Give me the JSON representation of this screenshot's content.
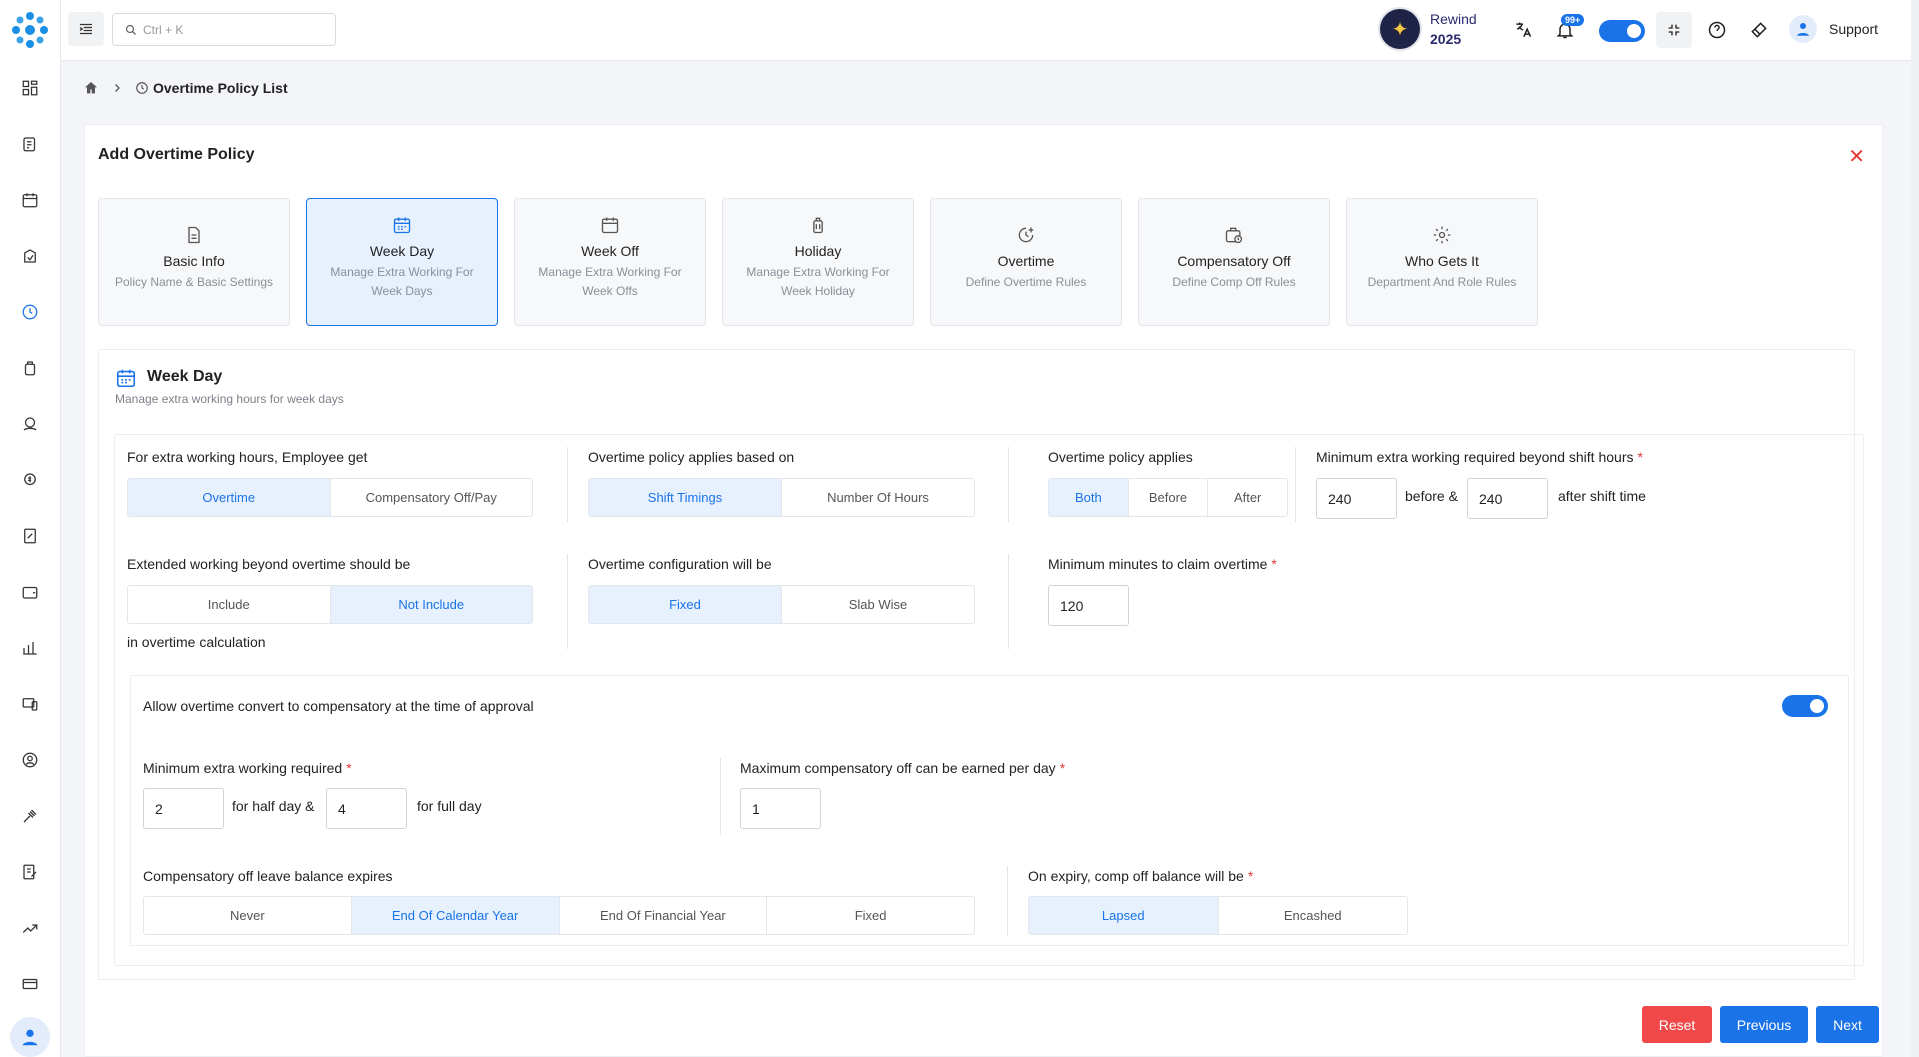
{
  "search": {
    "placeholder": "Ctrl + K"
  },
  "header": {
    "rewind_label": "Rewind",
    "rewind_year": "2025",
    "notifications_count": "99+",
    "support_label": "Support"
  },
  "breadcrumb": {
    "current": "Overtime Policy List"
  },
  "card": {
    "title": "Add Overtime Policy"
  },
  "steps": [
    {
      "title": "Basic Info",
      "sub": "Policy Name & Basic Settings",
      "icon": "document-icon"
    },
    {
      "title": "Week Day",
      "sub": "Manage Extra Working For Week Days",
      "icon": "calendar-icon"
    },
    {
      "title": "Week Off",
      "sub": "Manage Extra Working For Week Offs",
      "icon": "calendar-blank-icon"
    },
    {
      "title": "Holiday",
      "sub": "Manage Extra Working For Week Holiday",
      "icon": "luggage-icon"
    },
    {
      "title": "Overtime",
      "sub": "Define Overtime Rules",
      "icon": "clock-plus-icon"
    },
    {
      "title": "Compensatory Off",
      "sub": "Define Comp Off Rules",
      "icon": "briefcase-clock-icon"
    },
    {
      "title": "Who Gets It",
      "sub": "Department And Role Rules",
      "icon": "gear-icon"
    }
  ],
  "section": {
    "title": "Week Day",
    "subtitle": "Manage extra working hours for week days"
  },
  "form": {
    "employee_get": {
      "label": "For extra working hours, Employee get",
      "options": [
        "Overtime",
        "Compensatory Off/Pay"
      ],
      "selected": "Overtime"
    },
    "applies_based_on": {
      "label": "Overtime policy applies based on",
      "options": [
        "Shift Timings",
        "Number Of Hours"
      ],
      "selected": "Shift Timings"
    },
    "policy_applies": {
      "label": "Overtime policy applies",
      "options": [
        "Both",
        "Before",
        "After"
      ],
      "selected": "Both"
    },
    "min_extra_beyond_shift": {
      "label": "Minimum extra working required beyond shift hours",
      "before_value": "240",
      "mid_text": "before &",
      "after_value": "240",
      "after_text": "after shift time"
    },
    "extended_working": {
      "label": "Extended working beyond overtime should be",
      "options": [
        "Include",
        "Not Include"
      ],
      "selected": "Not Include",
      "suffix": "in overtime calculation"
    },
    "configuration": {
      "label": "Overtime configuration will be",
      "options": [
        "Fixed",
        "Slab Wise"
      ],
      "selected": "Fixed"
    },
    "min_minutes_claim": {
      "label": "Minimum minutes to claim overtime",
      "value": "120"
    },
    "convert_to_comp": {
      "label": "Allow overtime convert to compensatory at the time of approval",
      "enabled": true
    },
    "min_extra_required": {
      "label": "Minimum extra working required",
      "half_value": "2",
      "half_text": "for half day &",
      "full_value": "4",
      "full_text": "for full day"
    },
    "max_comp_per_day": {
      "label": "Maximum compensatory off can be earned per day",
      "value": "1"
    },
    "comp_expires": {
      "label": "Compensatory off leave balance expires",
      "options": [
        "Never",
        "End Of Calendar Year",
        "End Of Financial Year",
        "Fixed"
      ],
      "selected": "End Of Calendar Year"
    },
    "on_expiry": {
      "label": "On expiry, comp off balance will be",
      "options": [
        "Lapsed",
        "Encashed"
      ],
      "selected": "Lapsed"
    }
  },
  "buttons": {
    "reset": "Reset",
    "previous": "Previous",
    "next": "Next"
  },
  "colors": {
    "accent": "#1a73e8",
    "danger": "#f04848",
    "selected_bg": "#e7f1fd"
  }
}
